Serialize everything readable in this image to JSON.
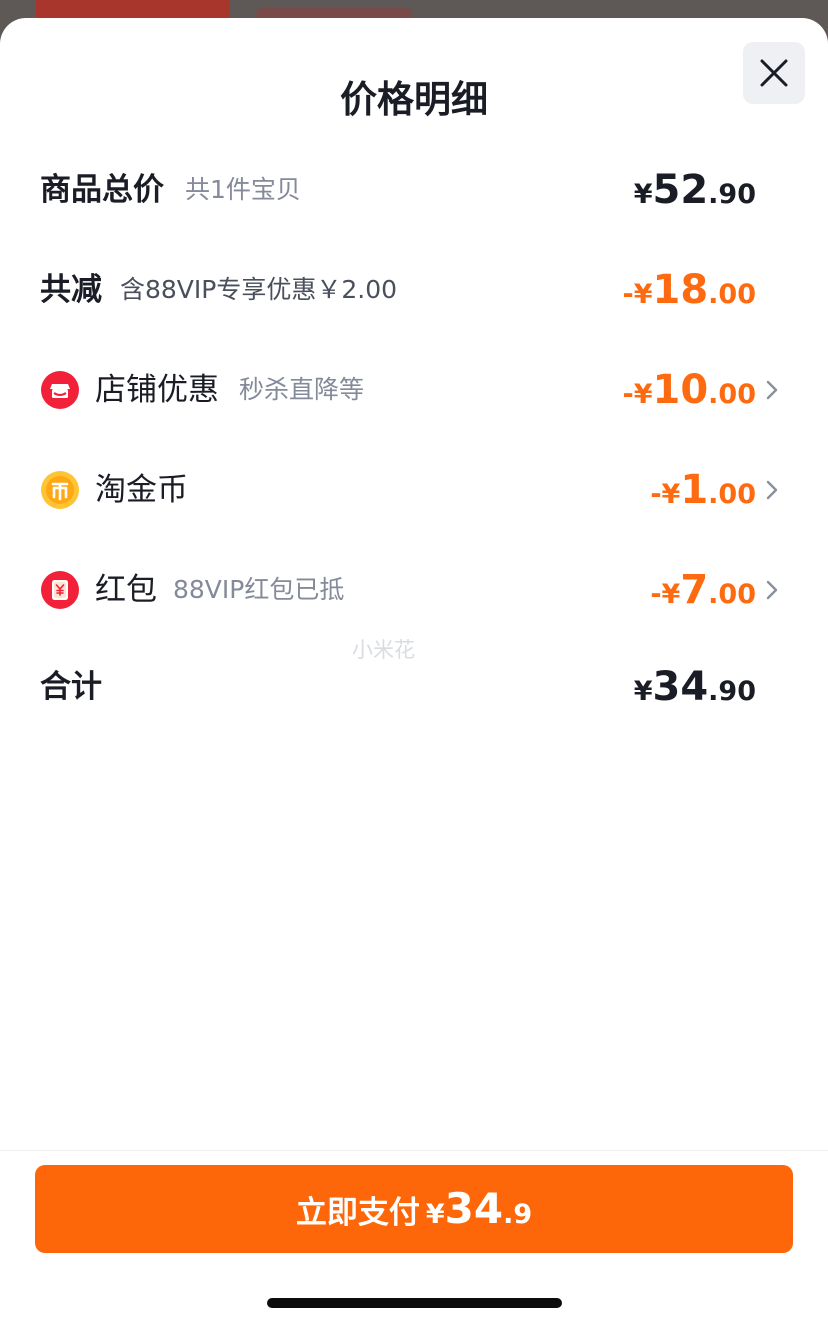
{
  "sheet": {
    "title": "价格明细",
    "close_icon": "close-icon"
  },
  "rows": {
    "goods_total": {
      "label": "商品总价",
      "sub": "共1件宝贝",
      "currency": "¥",
      "integer": "52",
      "decimal": ".90"
    },
    "total_discount": {
      "label": "共减",
      "sub": "含88VIP专享优惠￥2.00",
      "prefix": "-¥",
      "integer": "18",
      "decimal": ".00"
    },
    "shop_discount": {
      "icon": "shop-discount-icon",
      "label": "店铺优惠",
      "sub": "秒杀直降等",
      "prefix": "-¥",
      "integer": "10",
      "decimal": ".00"
    },
    "taojinbi": {
      "icon": "taojinbi-coin-icon",
      "label": "淘金币",
      "prefix": "-¥",
      "integer": "1",
      "decimal": ".00"
    },
    "red_packet": {
      "icon": "red-packet-icon",
      "label": "红包",
      "sub": "88VIP红包已抵",
      "prefix": "-¥",
      "integer": "7",
      "decimal": ".00"
    },
    "grand_total": {
      "label": "合计",
      "currency": "¥",
      "integer": "34",
      "decimal": ".90"
    }
  },
  "watermark": "小米花",
  "pay_button": {
    "label": "立即支付",
    "currency": "¥",
    "integer": "34",
    "decimal": ".9"
  },
  "colors": {
    "accent": "#fd6709",
    "discount": "#fd6a10",
    "text": "#1b1d26",
    "muted": "#848a99"
  }
}
